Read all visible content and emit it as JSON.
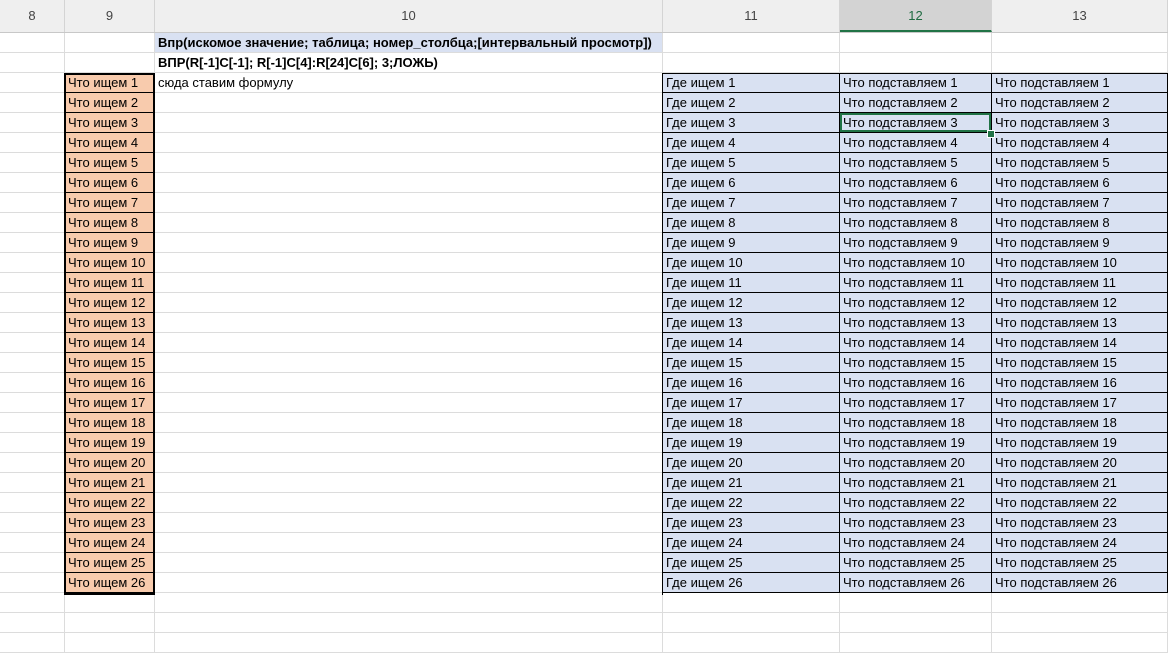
{
  "column_headers": [
    "8",
    "9",
    "10",
    "11",
    "12",
    "13"
  ],
  "selected_column": "12",
  "header_row1": "Впр(искомое значение; таблица; номер_столбца;[интервальный просмотр])",
  "header_row2": "ВПР(R[-1]C[-1]; R[-1]C[4]:R[24]C[6]; 3;ЛОЖЬ)",
  "formula_hint": "сюда ставим формулу",
  "rows": [
    {
      "search": "Что ищем 1",
      "where": "Где ищем 1",
      "sub1": "Что подставляем 1",
      "sub2": "Что подставляем 1"
    },
    {
      "search": "Что ищем 2",
      "where": "Где ищем 2",
      "sub1": "Что подставляем 2",
      "sub2": "Что подставляем 2"
    },
    {
      "search": "Что ищем 3",
      "where": "Где ищем 3",
      "sub1": "Что подставляем 3",
      "sub2": "Что подставляем 3"
    },
    {
      "search": "Что ищем 4",
      "where": "Где ищем 4",
      "sub1": "Что подставляем 4",
      "sub2": "Что подставляем 4"
    },
    {
      "search": "Что ищем 5",
      "where": "Где ищем 5",
      "sub1": "Что подставляем 5",
      "sub2": "Что подставляем 5"
    },
    {
      "search": "Что ищем 6",
      "where": "Где ищем 6",
      "sub1": "Что подставляем 6",
      "sub2": "Что подставляем 6"
    },
    {
      "search": "Что ищем 7",
      "where": "Где ищем 7",
      "sub1": "Что подставляем 7",
      "sub2": "Что подставляем 7"
    },
    {
      "search": "Что ищем 8",
      "where": "Где ищем 8",
      "sub1": "Что подставляем 8",
      "sub2": "Что подставляем 8"
    },
    {
      "search": "Что ищем 9",
      "where": "Где ищем 9",
      "sub1": "Что подставляем 9",
      "sub2": "Что подставляем 9"
    },
    {
      "search": "Что ищем 10",
      "where": "Где ищем 10",
      "sub1": "Что подставляем 10",
      "sub2": "Что подставляем 10"
    },
    {
      "search": "Что ищем 11",
      "where": "Где ищем 11",
      "sub1": "Что подставляем 11",
      "sub2": "Что подставляем 11"
    },
    {
      "search": "Что ищем 12",
      "where": "Где ищем 12",
      "sub1": "Что подставляем 12",
      "sub2": "Что подставляем 12"
    },
    {
      "search": "Что ищем 13",
      "where": "Где ищем 13",
      "sub1": "Что подставляем 13",
      "sub2": "Что подставляем 13"
    },
    {
      "search": "Что ищем 14",
      "where": "Где ищем 14",
      "sub1": "Что подставляем 14",
      "sub2": "Что подставляем 14"
    },
    {
      "search": "Что ищем 15",
      "where": "Где ищем 15",
      "sub1": "Что подставляем 15",
      "sub2": "Что подставляем 15"
    },
    {
      "search": "Что ищем 16",
      "where": "Где ищем 16",
      "sub1": "Что подставляем 16",
      "sub2": "Что подставляем 16"
    },
    {
      "search": "Что ищем 17",
      "where": "Где ищем 17",
      "sub1": "Что подставляем 17",
      "sub2": "Что подставляем 17"
    },
    {
      "search": "Что ищем 18",
      "where": "Где ищем 18",
      "sub1": "Что подставляем 18",
      "sub2": "Что подставляем 18"
    },
    {
      "search": "Что ищем 19",
      "where": "Где ищем 19",
      "sub1": "Что подставляем 19",
      "sub2": "Что подставляем 19"
    },
    {
      "search": "Что ищем 20",
      "where": "Где ищем 20",
      "sub1": "Что подставляем 20",
      "sub2": "Что подставляем 20"
    },
    {
      "search": "Что ищем 21",
      "where": "Где ищем 21",
      "sub1": "Что подставляем 21",
      "sub2": "Что подставляем 21"
    },
    {
      "search": "Что ищем 22",
      "where": "Где ищем 22",
      "sub1": "Что подставляем 22",
      "sub2": "Что подставляем 22"
    },
    {
      "search": "Что ищем 23",
      "where": "Где ищем 23",
      "sub1": "Что подставляем 23",
      "sub2": "Что подставляем 23"
    },
    {
      "search": "Что ищем 24",
      "where": "Где ищем 24",
      "sub1": "Что подставляем 24",
      "sub2": "Что подставляем 24"
    },
    {
      "search": "Что ищем 25",
      "where": "Где ищем 25",
      "sub1": "Что подставляем 25",
      "sub2": "Что подставляем 25"
    },
    {
      "search": "Что ищем 26",
      "where": "Где ищем 26",
      "sub1": "Что подставляем 26",
      "sub2": "Что подставляем 26"
    }
  ],
  "selected_cell": {
    "row_index": 2,
    "column": "12"
  },
  "colors": {
    "search_fill": "#f8cbad",
    "table_fill": "#d9e1f2",
    "selection": "#217346"
  }
}
